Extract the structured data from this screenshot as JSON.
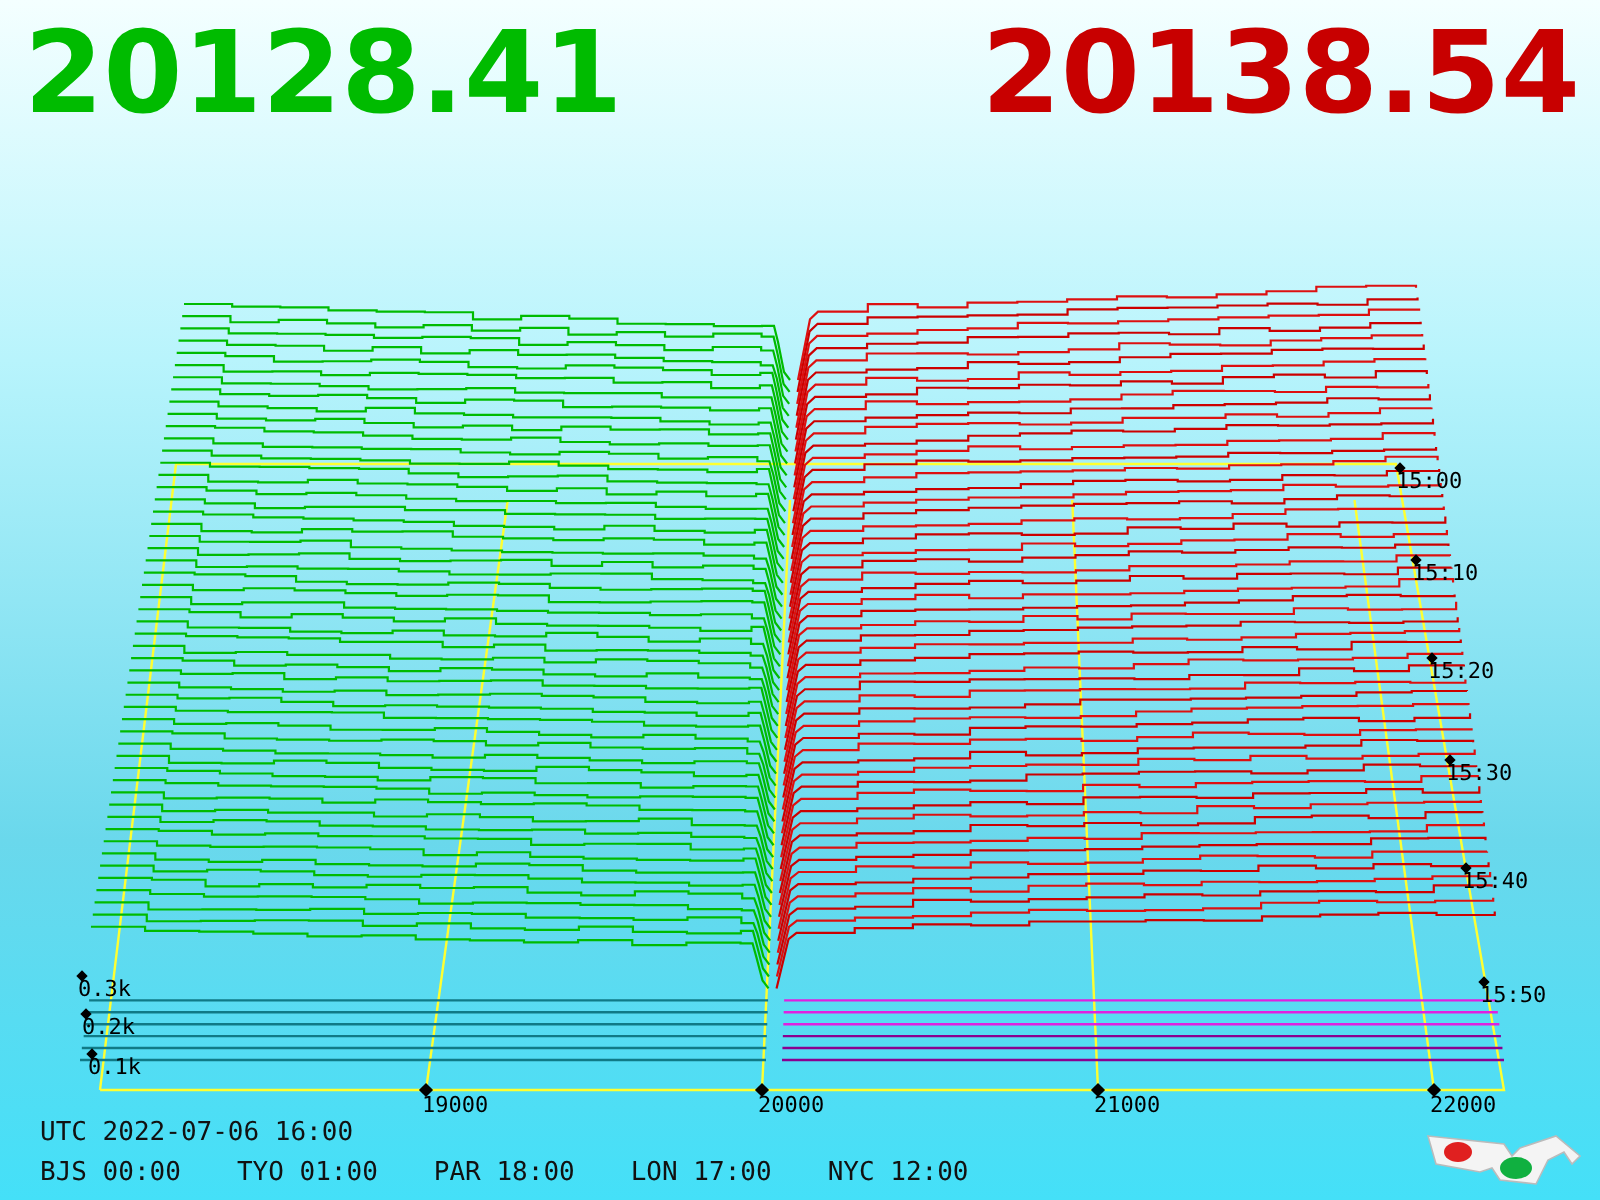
{
  "bid": "20128.41",
  "ask": "20138.54",
  "chart": {
    "price_ticks": [
      "19000",
      "20000",
      "21000",
      "22000"
    ],
    "volume_ticks": [
      "0.3k",
      "0.2k",
      "0.1k"
    ],
    "time_ticks": [
      "15:00",
      "15:10",
      "15:20",
      "15:30",
      "15:40",
      "15:50"
    ]
  },
  "utc": "UTC 2022-07-06 16:00",
  "clocks": [
    "BJS 00:00",
    "TYO 01:00",
    "PAR 18:00",
    "LON 17:00",
    "NYC 12:00"
  ]
}
